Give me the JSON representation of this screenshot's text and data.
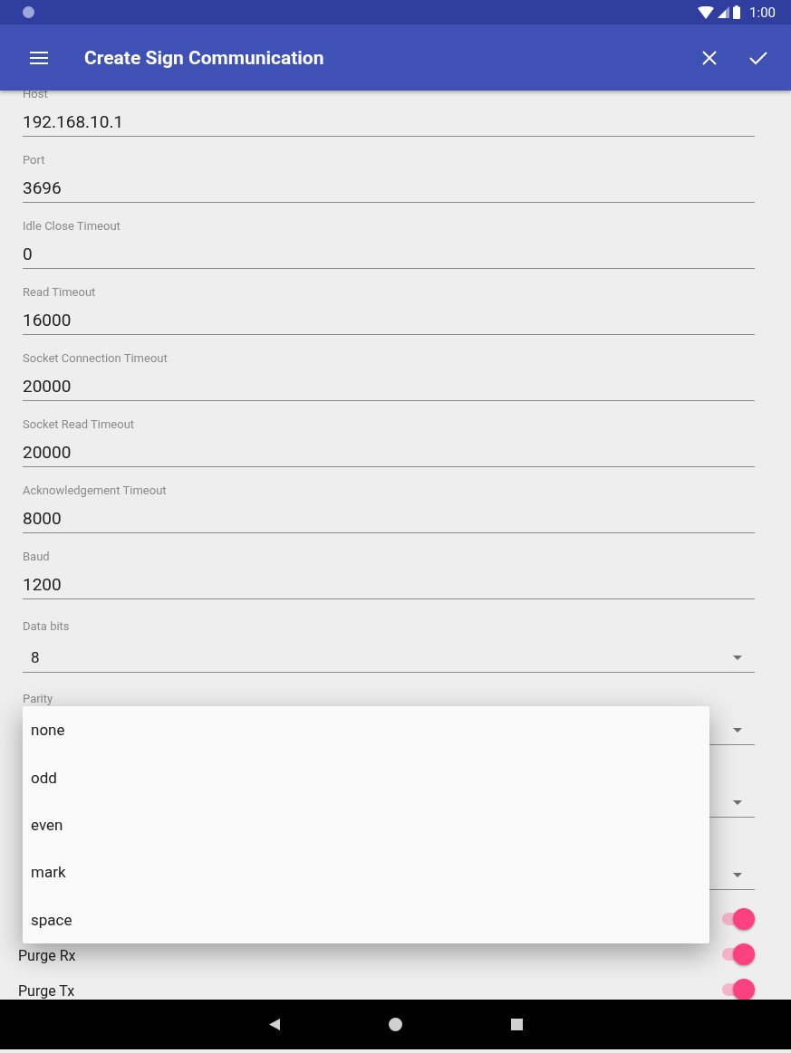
{
  "status_bar": {
    "time": "1:00"
  },
  "app_bar": {
    "title": "Create Sign Communication"
  },
  "fields": [
    {
      "kind": "text",
      "label": "Host",
      "value": "192.168.10.1"
    },
    {
      "kind": "text",
      "label": "Port",
      "value": "3696"
    },
    {
      "kind": "text",
      "label": "Idle Close Timeout",
      "value": "0"
    },
    {
      "kind": "text",
      "label": "Read Timeout",
      "value": "16000"
    },
    {
      "kind": "text",
      "label": "Socket Connection Timeout",
      "value": "20000"
    },
    {
      "kind": "text",
      "label": "Socket Read Timeout",
      "value": "20000"
    },
    {
      "kind": "text",
      "label": "Acknowledgement Timeout",
      "value": "8000"
    },
    {
      "kind": "text",
      "label": "Baud",
      "value": "1200"
    },
    {
      "kind": "spinner",
      "label": "Data bits",
      "value": "8"
    },
    {
      "kind": "spinner",
      "label": "Parity"
    },
    {
      "kind": "spinner"
    },
    {
      "kind": "spinner"
    }
  ],
  "switches": [
    {
      "on": true
    },
    {
      "label": "Purge Rx",
      "on": true
    },
    {
      "label": "Purge Tx",
      "on": true
    }
  ],
  "dropdown": {
    "options": [
      {
        "label": "none"
      },
      {
        "label": "odd"
      },
      {
        "label": "even"
      },
      {
        "label": "mark"
      },
      {
        "label": "space"
      }
    ]
  }
}
